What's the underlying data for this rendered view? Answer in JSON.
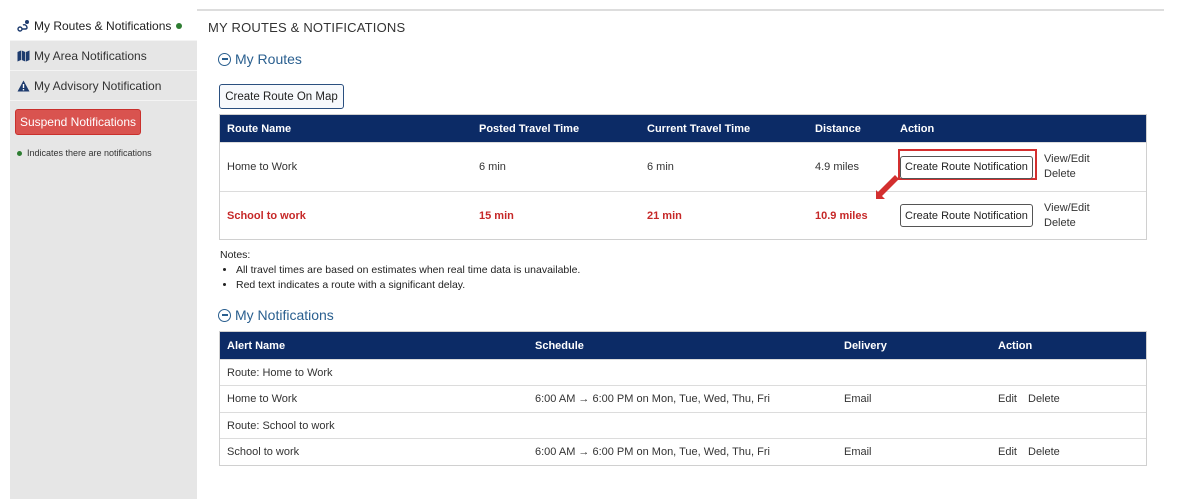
{
  "sidebar": {
    "items": [
      {
        "label": "My Routes & Notifications",
        "icon": "route-icon"
      },
      {
        "label": "My Area Notifications",
        "icon": "map-icon"
      },
      {
        "label": "My Advisory Notification",
        "icon": "warning-icon"
      }
    ],
    "suspend_label": "Suspend Notifications",
    "legend_text": "Indicates there are notifications"
  },
  "page_title": "MY ROUTES & NOTIFICATIONS",
  "routes_section": {
    "title": "My Routes",
    "create_button": "Create Route On Map",
    "columns": [
      "Route Name",
      "Posted Travel Time",
      "Current Travel Time",
      "Distance",
      "Action"
    ],
    "rows": [
      {
        "name": "Home to Work",
        "posted": "6 min",
        "current": "6 min",
        "distance": "4.9 miles",
        "delayed": false
      },
      {
        "name": "School to work",
        "posted": "15 min",
        "current": "21 min",
        "distance": "10.9 miles",
        "delayed": true
      }
    ],
    "action_button": "Create Route Notification",
    "view_edit": "View/Edit",
    "delete": "Delete"
  },
  "notes": {
    "title": "Notes:",
    "items": [
      "All travel times are based on estimates when real time data is unavailable.",
      "Red text indicates a route with a significant delay."
    ]
  },
  "notifications_section": {
    "title": "My Notifications",
    "columns": [
      "Alert Name",
      "Schedule",
      "Delivery",
      "Action"
    ],
    "groups": [
      {
        "title": "Route: Home to Work",
        "alert": "Home to Work",
        "schedule": "6:00 AM → 6:00 PM on Mon, Tue, Wed, Thu, Fri",
        "delivery": "Email"
      },
      {
        "title": "Route: School to work",
        "alert": "School to work",
        "schedule": "6:00 AM → 6:00 PM on Mon, Tue, Wed, Thu, Fri",
        "delivery": "Email"
      }
    ],
    "edit": "Edit",
    "delete": "Delete"
  },
  "colors": {
    "header_bg": "#0c2b66",
    "delay": "#c62828",
    "accent": "#2a5f8f",
    "suspend": "#d9534f",
    "notify_dot": "#2e7d32"
  }
}
